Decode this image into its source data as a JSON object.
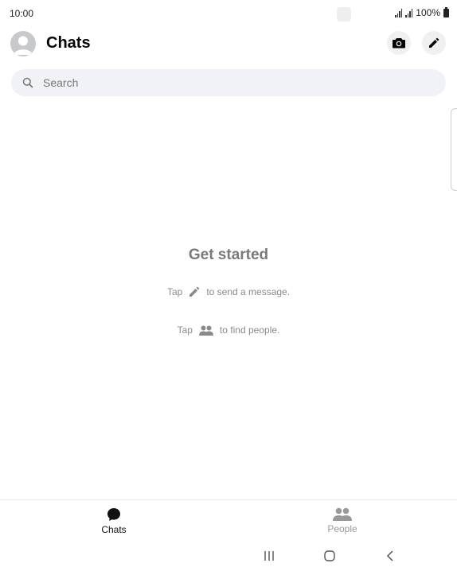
{
  "status_bar": {
    "time": "10:00",
    "battery": "100%"
  },
  "header": {
    "title": "Chats"
  },
  "search": {
    "placeholder": "Search"
  },
  "empty_state": {
    "title": "Get started",
    "hint1_prefix": "Tap",
    "hint1_suffix": "to send a message.",
    "hint2_prefix": "Tap",
    "hint2_suffix": "to find people."
  },
  "bottom_nav": {
    "tabs": [
      {
        "label": "Chats",
        "icon": "chat-bubble-icon",
        "active": true
      },
      {
        "label": "People",
        "icon": "people-icon",
        "active": false
      }
    ]
  },
  "colors": {
    "active_tab": "#111111",
    "inactive_tab": "#999999",
    "search_bg": "#f0f2f5",
    "hint_text": "#8a8a8a"
  }
}
